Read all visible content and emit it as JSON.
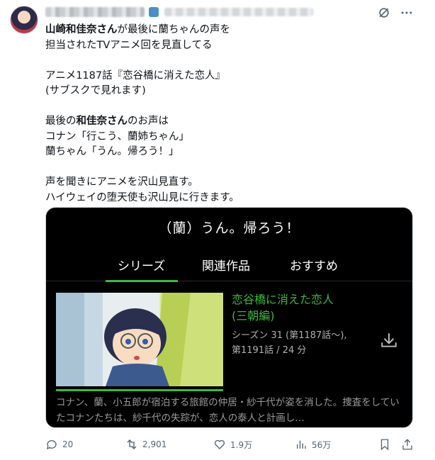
{
  "tweet": {
    "text_parts": [
      {
        "text": "山崎和佳奈さん",
        "bold": true
      },
      {
        "text": "が最後に蘭ちゃんの声を\n担当されたTVアニメ回を見直してる\n\nアニメ1187話『恋谷橋に消えた恋人』\n(サブスクで見れます)\n\n最後の",
        "bold": false
      },
      {
        "text": "和佳奈さん",
        "bold": true
      },
      {
        "text": "のお声は\nコナン「行こう、蘭姉ちゃん」\n蘭ちゃん「うん。帰ろう！」\n\n声を聞きにアニメを沢山見直す。\nハイウェイの堕天使も沢山見に行きます。",
        "bold": false
      }
    ]
  },
  "media": {
    "title": "（蘭）うん。帰ろう！",
    "tabs": [
      "シリーズ",
      "関連作品",
      "おすすめ"
    ],
    "episode_title_line1": "恋谷橋に消えた恋人",
    "episode_title_line2": "(三朝編)",
    "episode_meta_line1": "シーズン 31 (第1187話～),",
    "episode_meta_line2": "第1191話 / 24 分",
    "description": "コナン、蘭、小五郎が宿泊する旅館の仲居・紗千代が姿を消した。捜査をしていたコナンたちは、紗千代の失踪が、恋人の泰人と計画し…",
    "accent_color": "#3fb73f"
  },
  "actions": {
    "replies": "20",
    "retweets": "2,901",
    "likes": "1.9万",
    "views": "56万"
  }
}
